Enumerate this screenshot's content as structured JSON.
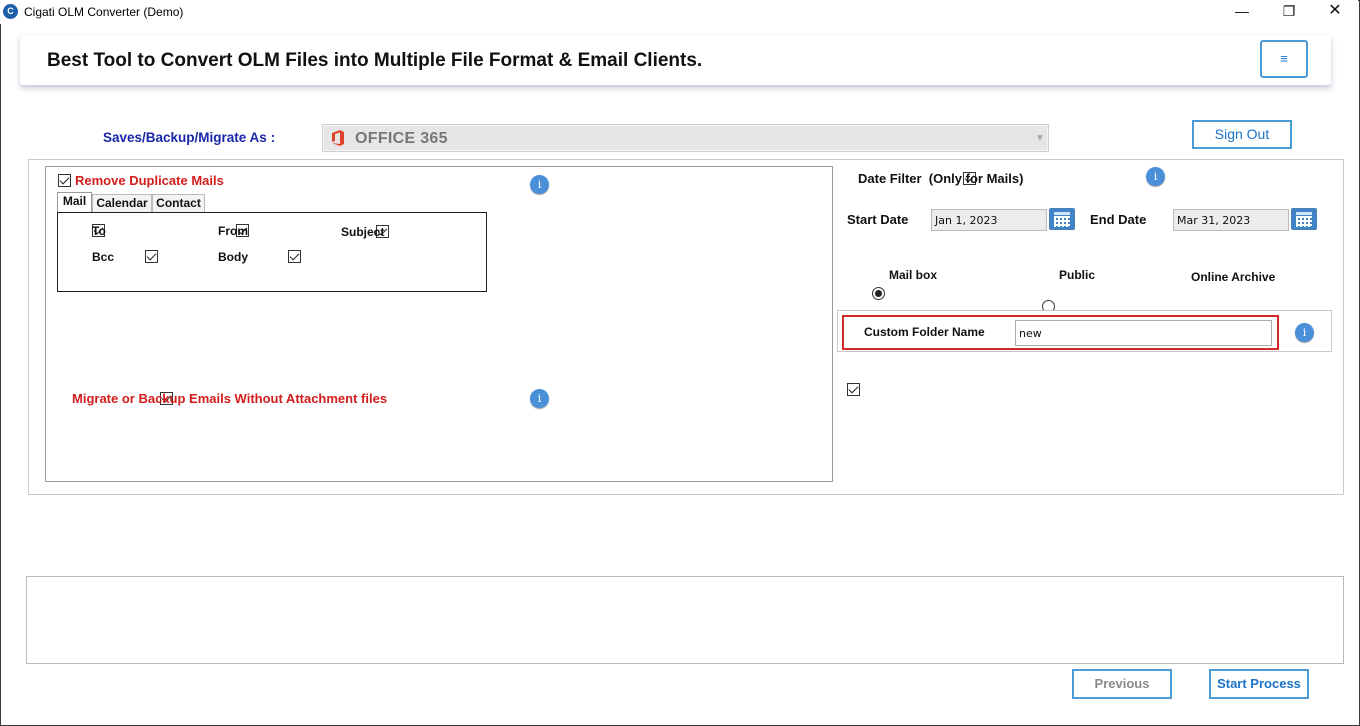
{
  "window": {
    "title": "Cigati OLM Converter (Demo)",
    "app_icon_letter": "C",
    "minimize_glyph": "—",
    "restore_glyph": "❐",
    "close_glyph": "✕"
  },
  "banner": {
    "title": "Best Tool to Convert OLM Files into Multiple File Format & Email Clients.",
    "menu_glyph": "≡"
  },
  "save_as": {
    "label": "Saves/Backup/Migrate As :",
    "selected": "OFFICE 365",
    "icon": "office-365-icon"
  },
  "sign_out_label": "Sign Out",
  "duplicates": {
    "label": "Remove Duplicate Mails",
    "checked": true,
    "tabs": [
      "Mail",
      "Calendar",
      "Contact"
    ],
    "active_tab": "Mail",
    "fields": {
      "to": "To",
      "from": "From",
      "subject": "Subject",
      "bcc": "Bcc",
      "body": "Body"
    }
  },
  "without_attachment": {
    "label": "Migrate or Backup Emails Without Attachment files",
    "checked": true
  },
  "date_filter": {
    "label": "Date Filter  (Only for Mails)",
    "checked": true,
    "start_label": "Start Date",
    "start_value": "Jan 1, 2023",
    "end_label": "End Date",
    "end_value": "Mar 31, 2023"
  },
  "mailbox_type": {
    "options": [
      "Mail box",
      "Public",
      "Online Archive"
    ],
    "selected": "Mail box"
  },
  "custom_folder": {
    "label": "Custom Folder Name",
    "checked": true,
    "value": "new"
  },
  "info_glyph": "i",
  "footer": {
    "previous_label": "Previous",
    "start_label": "Start Process"
  },
  "colors": {
    "accent_blue": "#4a9bd6",
    "label_blue": "#1a27a8",
    "warning_red": "#d21d1d",
    "highlight_red": "#d22a2a"
  }
}
